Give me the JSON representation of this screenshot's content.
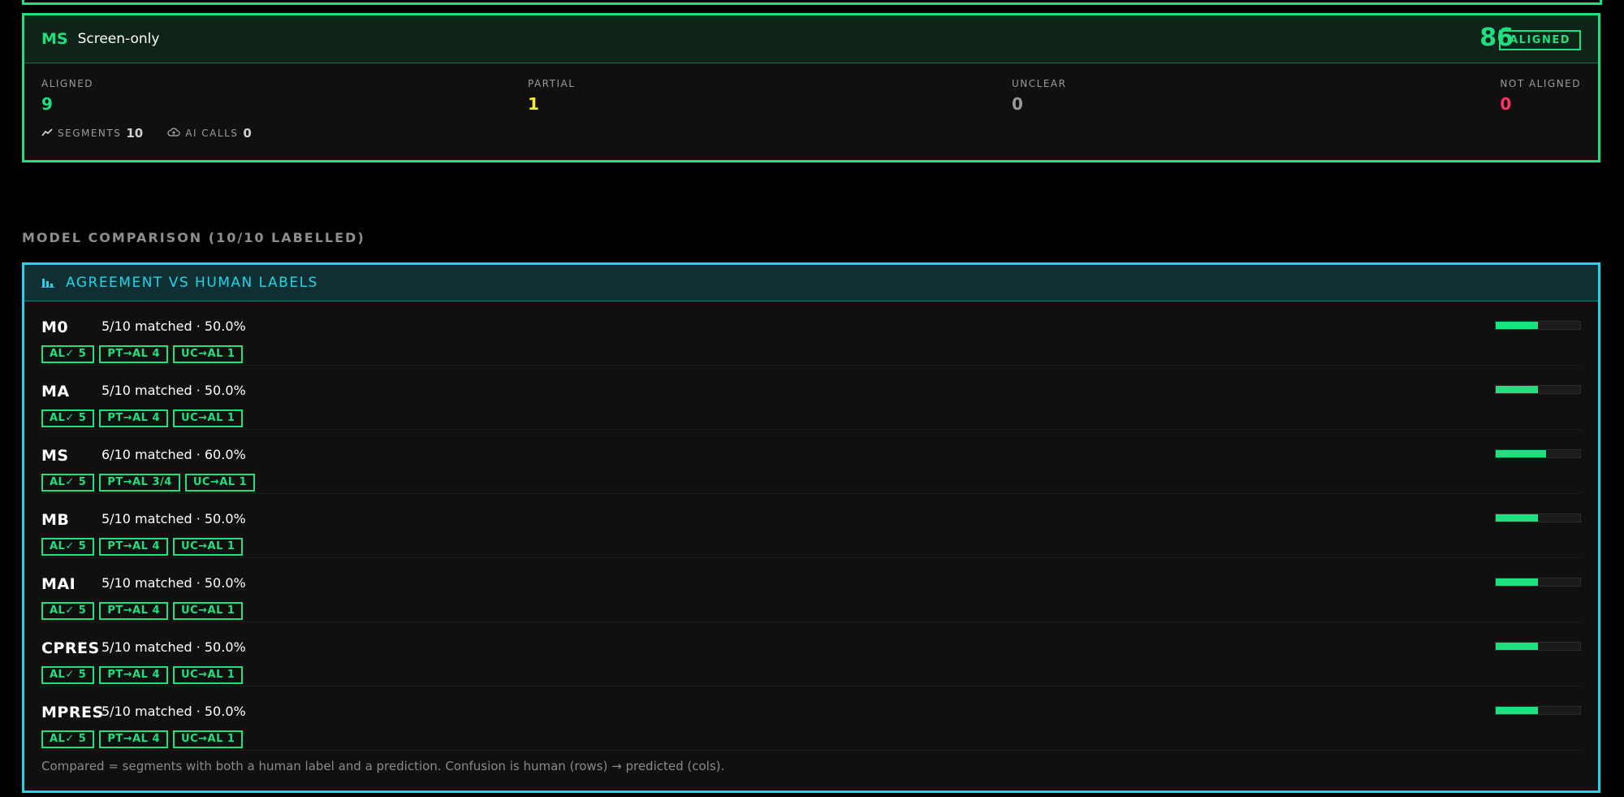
{
  "model_summary": {
    "code": "MS",
    "title": "Screen-only",
    "score": "86",
    "verdict": "ALIGNED",
    "stats": [
      {
        "label": "ALIGNED",
        "value": "9",
        "color": "#1ee07f"
      },
      {
        "label": "PARTIAL",
        "value": "1",
        "color": "#f4e93a"
      },
      {
        "label": "UNCLEAR",
        "value": "0",
        "color": "#9a9a9a"
      },
      {
        "label": "NOT ALIGNED",
        "value": "0",
        "color": "#ff3366"
      }
    ],
    "meta": {
      "segments_label": "SEGMENTS",
      "segments_value": "10",
      "ai_calls_label": "AI CALLS",
      "ai_calls_value": "0",
      "segments_icon": "trend-line-icon",
      "ai_calls_icon": "cloud-upload-icon"
    }
  },
  "comparison": {
    "section_title": "MODEL COMPARISON (10/10 LABELLED)",
    "card_title": "AGREEMENT VS HUMAN LABELS",
    "card_icon": "bar-chart-icon",
    "rows": [
      {
        "name": "M0",
        "matched": "5/10 matched · 50.0%",
        "agreement": 0.5,
        "tags": [
          "AL✓ 5",
          "PT→AL 4",
          "UC→AL 1"
        ]
      },
      {
        "name": "MA",
        "matched": "5/10 matched · 50.0%",
        "agreement": 0.5,
        "tags": [
          "AL✓ 5",
          "PT→AL 4",
          "UC→AL 1"
        ]
      },
      {
        "name": "MS",
        "matched": "6/10 matched · 60.0%",
        "agreement": 0.6,
        "tags": [
          "AL✓ 5",
          "PT→AL 3/4",
          "UC→AL 1"
        ]
      },
      {
        "name": "MB",
        "matched": "5/10 matched · 50.0%",
        "agreement": 0.5,
        "tags": [
          "AL✓ 5",
          "PT→AL 4",
          "UC→AL 1"
        ]
      },
      {
        "name": "MAI",
        "matched": "5/10 matched · 50.0%",
        "agreement": 0.5,
        "tags": [
          "AL✓ 5",
          "PT→AL 4",
          "UC→AL 1"
        ]
      },
      {
        "name": "CPRES",
        "matched": "5/10 matched · 50.0%",
        "agreement": 0.5,
        "tags": [
          "AL✓ 5",
          "PT→AL 4",
          "UC→AL 1"
        ]
      },
      {
        "name": "MPRES",
        "matched": "5/10 matched · 50.0%",
        "agreement": 0.5,
        "tags": [
          "AL✓ 5",
          "PT→AL 4",
          "UC→AL 1"
        ]
      }
    ],
    "footnote": "Compared = segments with both a human label and a prediction. Confusion is human (rows) → predicted (cols)."
  },
  "colors": {
    "accent_green": "#1ee07f",
    "accent_cyan": "#1fd6e8",
    "partial_yellow": "#f4e93a",
    "not_aligned_red": "#ff3366"
  }
}
